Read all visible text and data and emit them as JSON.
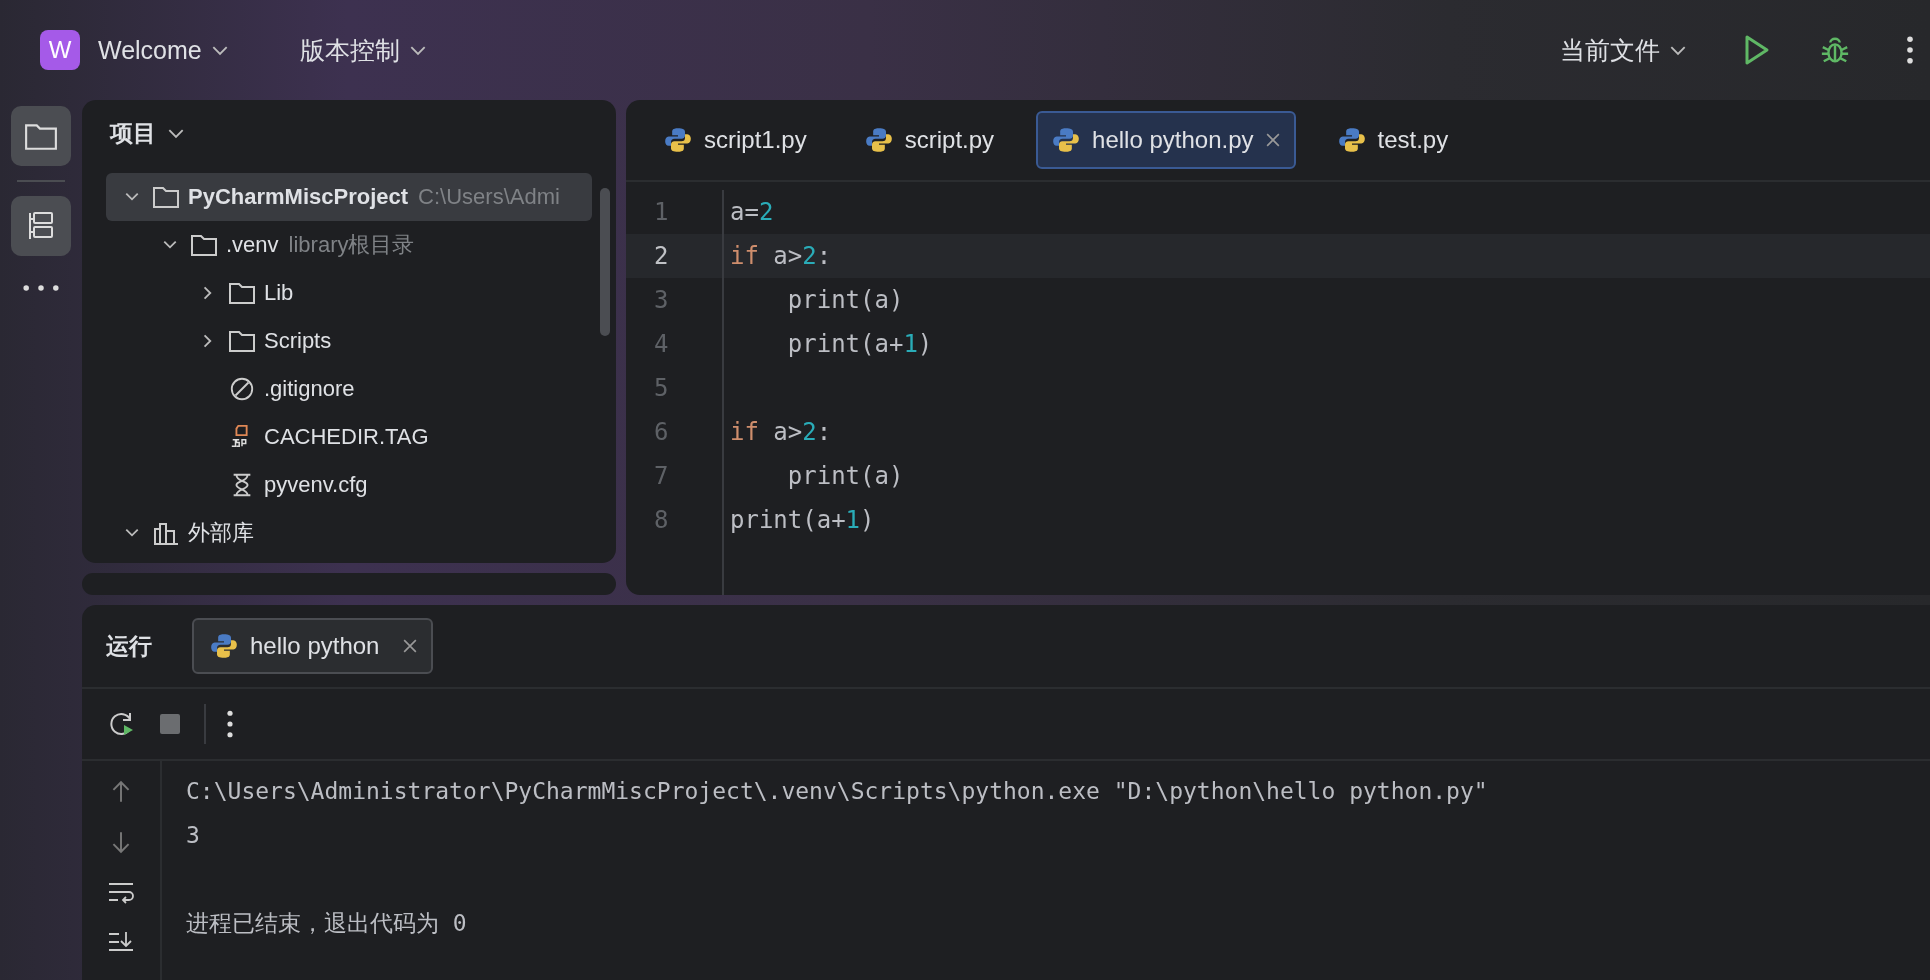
{
  "header": {
    "project_badge": "W",
    "project": "Welcome",
    "vcs": "版本控制",
    "run_config": "当前文件"
  },
  "project_panel": {
    "title": "项目",
    "tree": [
      {
        "name": "PyCharmMiscProject",
        "hint": "C:\\Users\\Admi",
        "kind": "folder",
        "expanded": true,
        "selected": true,
        "children": [
          {
            "name": ".venv",
            "hint": "library根目录",
            "kind": "folder",
            "expanded": true,
            "selected": false,
            "children": [
              {
                "name": "Lib",
                "kind": "folder",
                "expanded": false,
                "selected": false
              },
              {
                "name": "Scripts",
                "kind": "folder",
                "expanded": false,
                "selected": false
              },
              {
                "name": ".gitignore",
                "kind": "ignore",
                "selected": false
              },
              {
                "name": "CACHEDIR.TAG",
                "kind": "tag",
                "selected": false
              },
              {
                "name": "pyvenv.cfg",
                "kind": "config",
                "selected": false
              }
            ]
          }
        ]
      },
      {
        "name": "外部库",
        "kind": "library",
        "expanded": true,
        "selected": false
      }
    ]
  },
  "editor": {
    "tabs": [
      {
        "label": "script1.py",
        "selected": false
      },
      {
        "label": "script.py",
        "selected": false
      },
      {
        "label": "hello python.py",
        "selected": true
      },
      {
        "label": "test.py",
        "selected": false
      }
    ],
    "lines": [
      {
        "number": "1",
        "current": false,
        "tokens": [
          {
            "text": "a=",
            "kind": "plain"
          },
          {
            "text": "2",
            "kind": "number"
          }
        ]
      },
      {
        "number": "2",
        "current": true,
        "tokens": [
          {
            "text": "if",
            "kind": "keyword"
          },
          {
            "text": " a>",
            "kind": "plain"
          },
          {
            "text": "2",
            "kind": "number"
          },
          {
            "text": ":",
            "kind": "plain"
          }
        ]
      },
      {
        "number": "3",
        "current": false,
        "tokens": [
          {
            "text": "    print(a)",
            "kind": "plain"
          }
        ]
      },
      {
        "number": "4",
        "current": false,
        "tokens": [
          {
            "text": "    print(a+",
            "kind": "plain"
          },
          {
            "text": "1",
            "kind": "number"
          },
          {
            "text": ")",
            "kind": "plain"
          }
        ]
      },
      {
        "number": "5",
        "current": false
      },
      {
        "number": "6",
        "current": false,
        "tokens": [
          {
            "text": "if",
            "kind": "keyword"
          },
          {
            "text": " a>",
            "kind": "plain"
          },
          {
            "text": "2",
            "kind": "number"
          },
          {
            "text": ":",
            "kind": "plain"
          }
        ]
      },
      {
        "number": "7",
        "current": false,
        "tokens": [
          {
            "text": "    print(a)",
            "kind": "plain"
          }
        ]
      },
      {
        "number": "8",
        "current": false,
        "tokens": [
          {
            "text": "print(a+",
            "kind": "plain"
          },
          {
            "text": "1",
            "kind": "number"
          },
          {
            "text": ")",
            "kind": "plain"
          }
        ]
      }
    ]
  },
  "run_panel": {
    "title": "运行",
    "tab": "hello python",
    "output": [
      {
        "text": "C:\\Users\\Administrator\\PyCharmMiscProject\\.venv\\Scripts\\python.exe \"D:\\python\\hello python.py\""
      },
      {
        "text": "3"
      },
      {
        "text": "进程已结束，退出代码为 0",
        "gap_before": true
      }
    ]
  }
}
